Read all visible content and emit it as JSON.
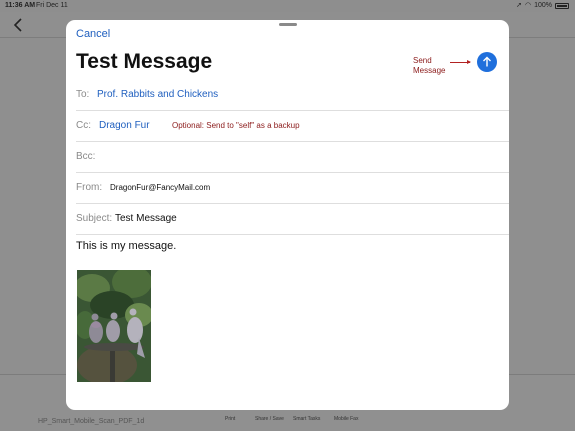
{
  "status": {
    "time": "11:36 AM",
    "date": "Fri Dec 11",
    "battery": "100%"
  },
  "background": {
    "filename": "HP_Smart_Mobile_Scan_PDF_1d",
    "toolbar": [
      "Print",
      "Share / Save",
      "Smart Tasks",
      "Mobile Fax"
    ]
  },
  "compose": {
    "cancel": "Cancel",
    "title": "Test Message",
    "send_note": [
      "Send",
      "Message"
    ],
    "to": {
      "label": "To:",
      "value": "Prof. Rabbits and Chickens"
    },
    "cc": {
      "label": "Cc:",
      "value": "Dragon Fur",
      "note": "Optional:  Send to \"self\" as a backup"
    },
    "bcc": {
      "label": "Bcc:"
    },
    "from": {
      "label": "From:",
      "value": "DragonFur@FancyMail.com"
    },
    "subject": {
      "label": "Subject:",
      "value": "Test Message"
    },
    "body": "This is my message."
  },
  "colors": {
    "accent": "#1f6fdc",
    "link": "#1f5fbf",
    "annotation": "#8b1a1a"
  }
}
